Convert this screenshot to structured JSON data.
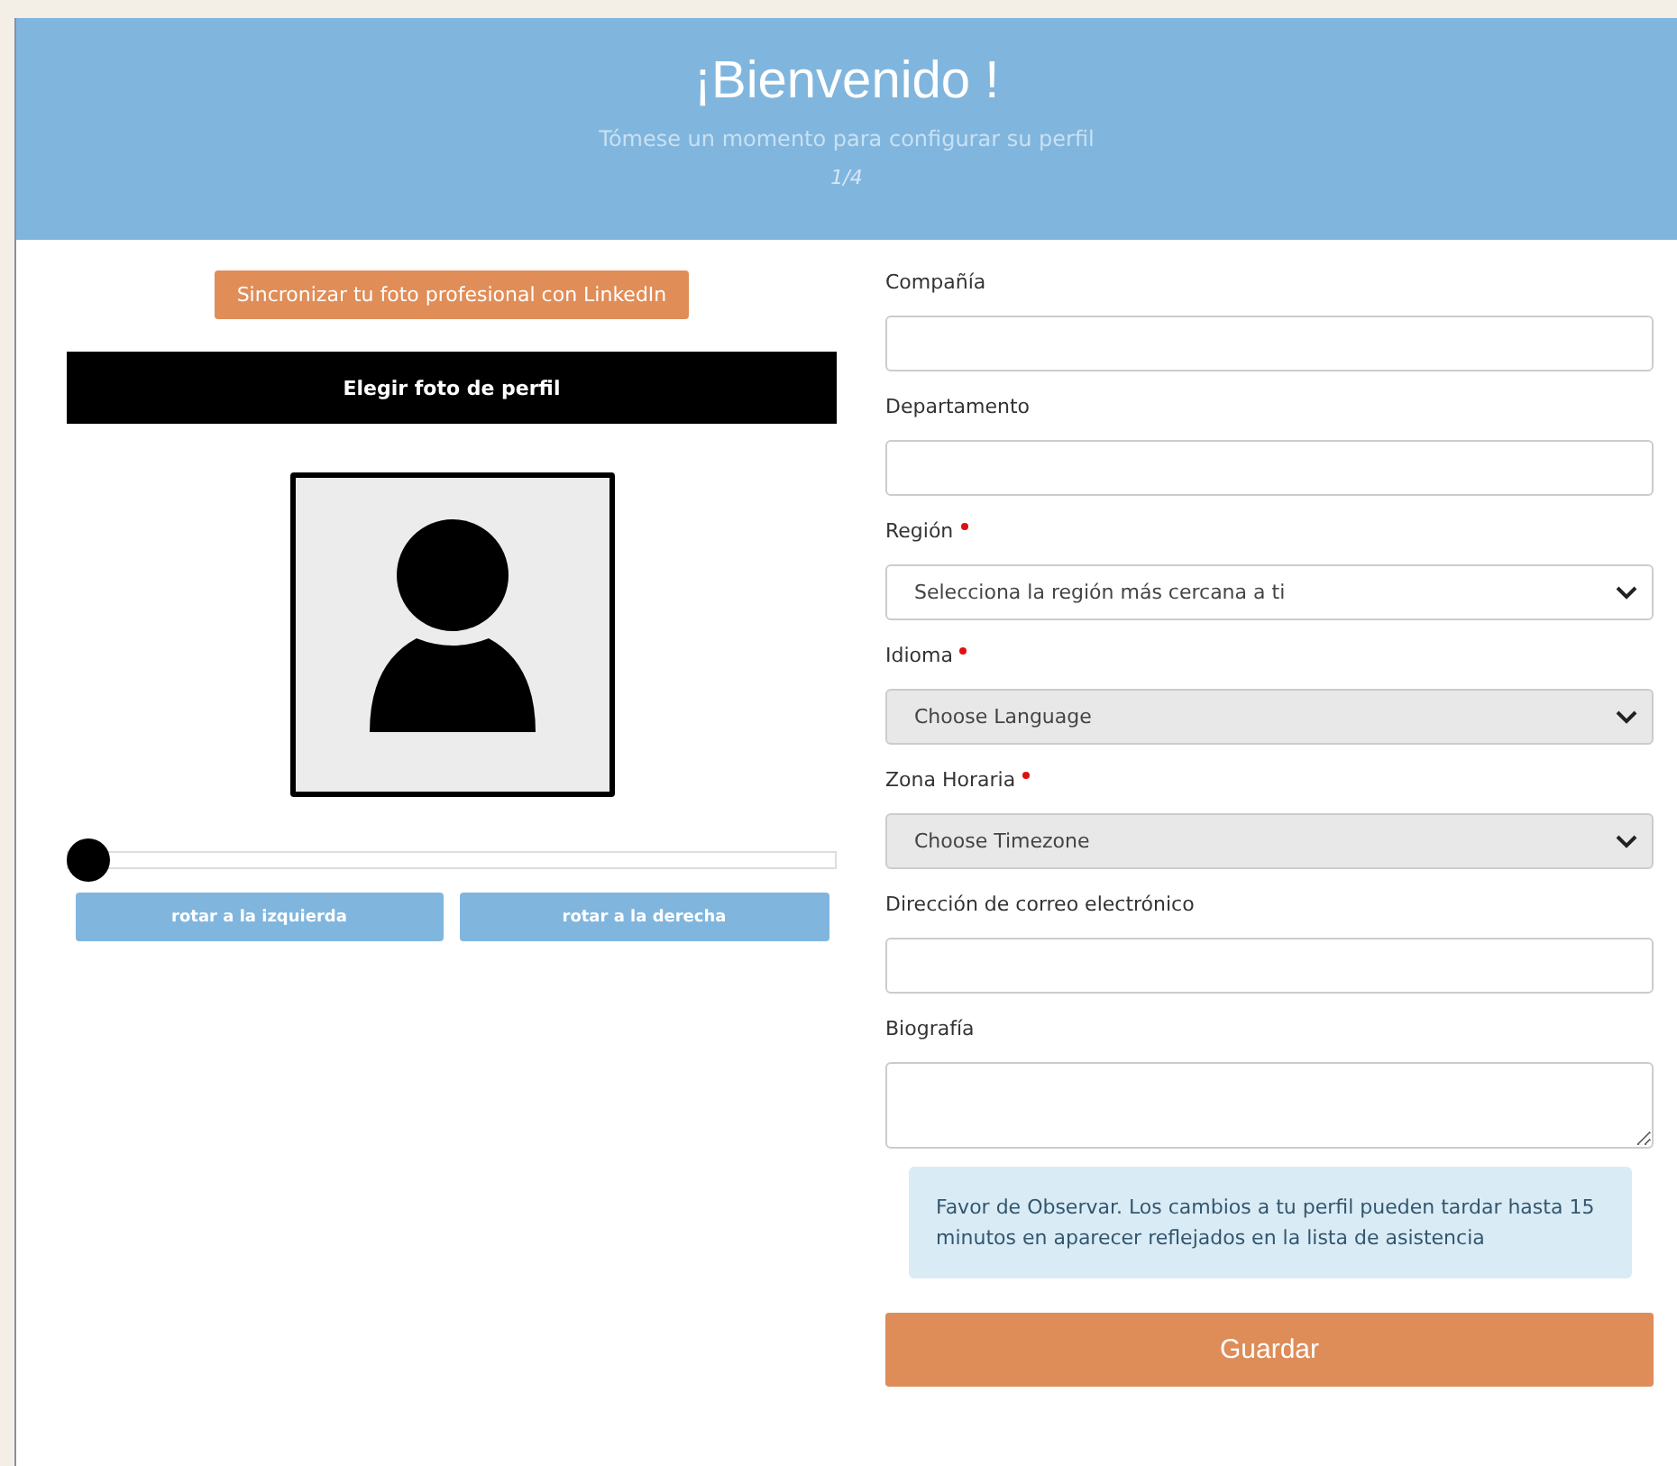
{
  "header": {
    "title": "¡Bienvenido !",
    "subtitle": "Tómese un momento para configurar su perfil",
    "step": "1/4"
  },
  "photo": {
    "linkedin_button": "Sincronizar tu foto profesional con LinkedIn",
    "choose_button": "Elegir foto de perfil",
    "zoom_slider": {
      "level": 0
    },
    "rotate_buttons": [
      "rotar a la izquierda",
      "rotar a la derecha"
    ]
  },
  "fields": [
    {
      "kind": "text",
      "label": "Compañía",
      "required": false
    },
    {
      "kind": "text",
      "label": "Departamento",
      "required": false
    },
    {
      "kind": "select",
      "label": "Región",
      "required": true,
      "value": "Selecciona la región más cercana a ti",
      "disabled": false
    },
    {
      "kind": "select",
      "label": "Idioma",
      "required": true,
      "value": "Choose Language",
      "disabled": true
    },
    {
      "kind": "select",
      "label": "Zona Horaria",
      "required": true,
      "value": "Choose Timezone",
      "disabled": true
    },
    {
      "kind": "text",
      "label": "Dirección de correo electrónico",
      "required": false
    },
    {
      "kind": "textarea",
      "label": "Biografía",
      "required": false
    }
  ],
  "notice": "Favor de Observar. Los cambios a tu perfil pueden tardar hasta 15 minutos en aparecer reflejados en la lista de asistencia",
  "save_button": "Guardar"
}
